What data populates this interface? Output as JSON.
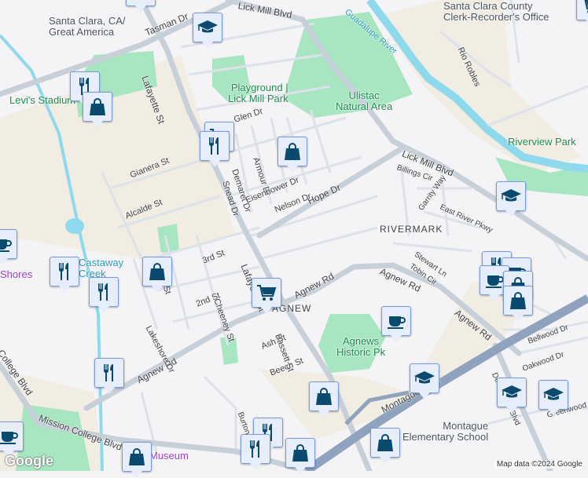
{
  "map": {
    "attribution": "Map data ©2024 Google",
    "logo": "Google",
    "colors": {
      "land": "#f4f3f5",
      "park": "#a8e6c1",
      "water": "#8fd9ec",
      "road": "#d3dae3",
      "highway": "#8fa3bf",
      "tan": "#f2ede2",
      "marker_bg": "#e6edfb",
      "marker_icon": "#0b4a6f"
    },
    "labels": {
      "station": "Santa Clara, CA/\nGreat America",
      "tasman": "Tasman Dr",
      "lick_mill_top": "Lick Mill Blvd",
      "lafayette_top": "Lafayette St",
      "levis": "Levi's Stadium",
      "playground": "Playground |\nLick Mill Park",
      "ulistac": "Ulistac\nNatural Area",
      "clerk": "Santa Clara County\nClerk-Recorder's Office",
      "river": "Guadalupe River",
      "rio_robles": "Rio Robles",
      "riverview": "Riverview Park",
      "glen": "Glen Dr",
      "gianera": "Gianera St",
      "alcalde": "Alcalde St",
      "snead": "Snead Dr",
      "demaret": "Demaret Dr",
      "armour": "Armour Dr",
      "eisenhower": "Eisenhower Dr",
      "nelson": "Nelson Dr",
      "hope": "Hope Dr",
      "lick_mill": "Lick Mill Blvd",
      "billings": "Billings Cir",
      "garrity": "Garrity Way",
      "east_river": "East River Pkwy",
      "rivermark": "RIVERMARK",
      "stewart": "Stewart Ln",
      "tobin": "Tobin Cir",
      "agnew_mid": "Agnew Rd",
      "agnew_right": "Agnew Rd",
      "agnew_left": "Agnew Rd",
      "agnew_nb": "AGNEW",
      "lafayette_mid": "Lafayette St",
      "fuller": "Fuller St",
      "third": "3rd St",
      "second": "2nd St",
      "cheeney": "Cheeney St",
      "lakeshore": "Lakeshore Dr",
      "ash": "Ash St",
      "beech": "Beech St",
      "bassett": "Bassett St",
      "castaway": "Castaway\nCreek",
      "shores": "Shores",
      "agnews_park": "Agnews\nHistoric Pk",
      "montague": "Montague Expy",
      "bellwood": "Bellwood Dr",
      "oakwood": "Oakwood Dr",
      "greenwood": "Greenwood",
      "de_la_cruz": "De La Cruz Blvd",
      "montague_school": "Montague\nElementary School",
      "college": "College Blvd",
      "mission": "Mission College Blvd",
      "museum": "Museum",
      "burton": "Burton"
    }
  }
}
